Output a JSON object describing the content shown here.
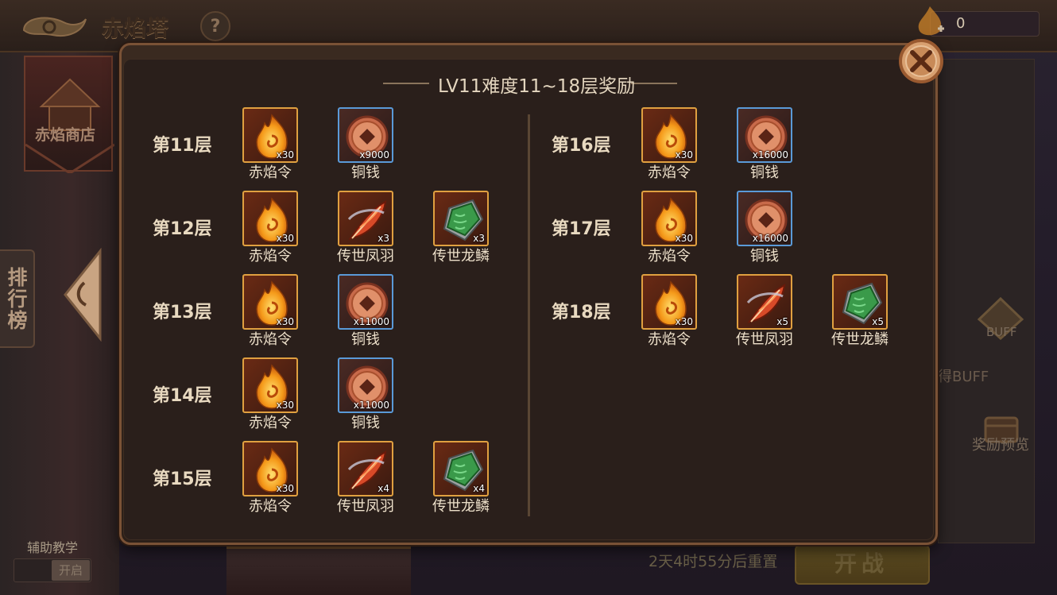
{
  "header": {
    "title": "赤焰塔",
    "help_icon": "?",
    "currency_value": "0"
  },
  "left": {
    "shop_label": "赤焰商店",
    "ranking_label": "排行榜",
    "tutorial_label": "辅助教学",
    "tutorial_toggle": "开启"
  },
  "right": {
    "buff_label": "BUFF",
    "buff_text": "得BUFF",
    "preview_label": "奖励预览",
    "reset_text": "2天4时55分后重置",
    "start_label": "开战"
  },
  "modal": {
    "title": "LV11难度11~18层奖励",
    "left_floors": [
      {
        "label": "第11层",
        "items": [
          {
            "name": "赤焰令",
            "count": "x30",
            "icon": "flame-token-icon",
            "frame": "orange"
          },
          {
            "name": "铜钱",
            "count": "x9000",
            "icon": "copper-coin-icon",
            "frame": "blue"
          }
        ]
      },
      {
        "label": "第12层",
        "items": [
          {
            "name": "赤焰令",
            "count": "x30",
            "icon": "flame-token-icon",
            "frame": "orange"
          },
          {
            "name": "传世凤羽",
            "count": "x3",
            "icon": "phoenix-feather-icon",
            "frame": "orange"
          },
          {
            "name": "传世龙鳞",
            "count": "x3",
            "icon": "dragon-scale-icon",
            "frame": "orange"
          }
        ]
      },
      {
        "label": "第13层",
        "items": [
          {
            "name": "赤焰令",
            "count": "x30",
            "icon": "flame-token-icon",
            "frame": "orange"
          },
          {
            "name": "铜钱",
            "count": "x11000",
            "icon": "copper-coin-icon",
            "frame": "blue"
          }
        ]
      },
      {
        "label": "第14层",
        "items": [
          {
            "name": "赤焰令",
            "count": "x30",
            "icon": "flame-token-icon",
            "frame": "orange"
          },
          {
            "name": "铜钱",
            "count": "x11000",
            "icon": "copper-coin-icon",
            "frame": "blue"
          }
        ]
      },
      {
        "label": "第15层",
        "items": [
          {
            "name": "赤焰令",
            "count": "x30",
            "icon": "flame-token-icon",
            "frame": "orange"
          },
          {
            "name": "传世凤羽",
            "count": "x4",
            "icon": "phoenix-feather-icon",
            "frame": "orange"
          },
          {
            "name": "传世龙鳞",
            "count": "x4",
            "icon": "dragon-scale-icon",
            "frame": "orange"
          }
        ]
      }
    ],
    "right_floors": [
      {
        "label": "第16层",
        "items": [
          {
            "name": "赤焰令",
            "count": "x30",
            "icon": "flame-token-icon",
            "frame": "orange"
          },
          {
            "name": "铜钱",
            "count": "x16000",
            "icon": "copper-coin-icon",
            "frame": "blue"
          }
        ]
      },
      {
        "label": "第17层",
        "items": [
          {
            "name": "赤焰令",
            "count": "x30",
            "icon": "flame-token-icon",
            "frame": "orange"
          },
          {
            "name": "铜钱",
            "count": "x16000",
            "icon": "copper-coin-icon",
            "frame": "blue"
          }
        ]
      },
      {
        "label": "第18层",
        "items": [
          {
            "name": "赤焰令",
            "count": "x30",
            "icon": "flame-token-icon",
            "frame": "orange"
          },
          {
            "name": "传世凤羽",
            "count": "x5",
            "icon": "phoenix-feather-icon",
            "frame": "orange"
          },
          {
            "name": "传世龙鳞",
            "count": "x5",
            "icon": "dragon-scale-icon",
            "frame": "orange"
          }
        ]
      }
    ]
  },
  "colors": {
    "orange_frame": "#e0a040",
    "blue_frame": "#5a9ad8",
    "modal_border": "#7a5236"
  }
}
